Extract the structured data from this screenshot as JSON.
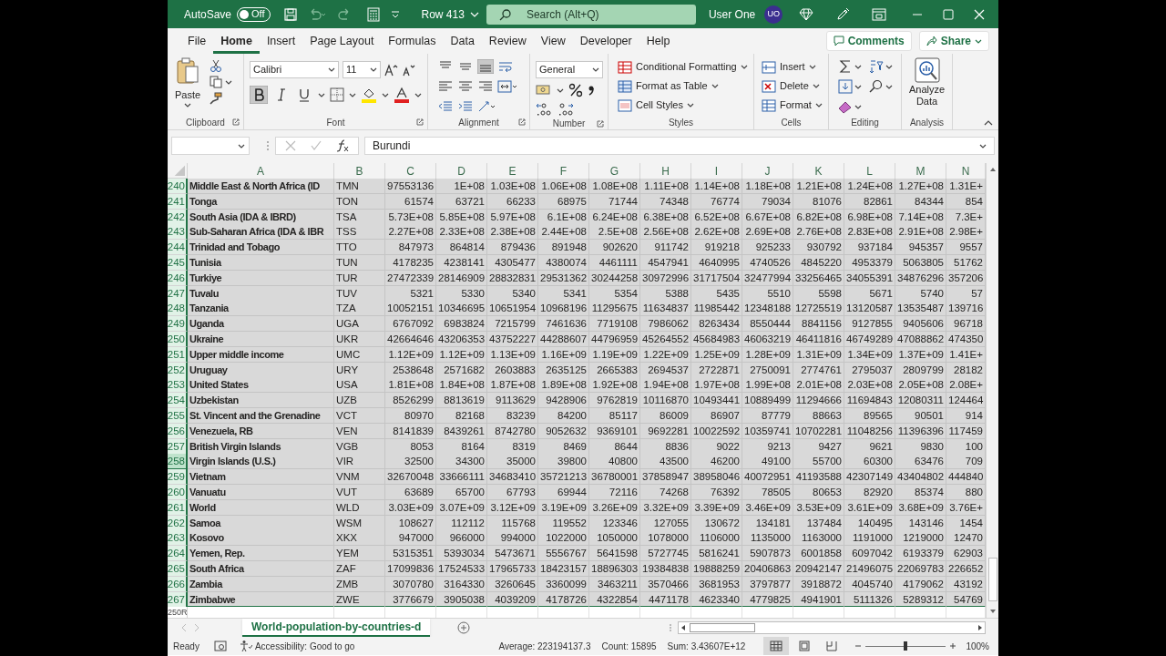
{
  "title_bar": {
    "autosave_label": "AutoSave",
    "autosave_toggle": {
      "label": "Off",
      "on": false
    },
    "file_name": "Row 413",
    "search": {
      "placeholder": "Search (Alt+Q)"
    },
    "user_name": "User One",
    "user_initials": "UO"
  },
  "ribbon_tabs": [
    {
      "label": "File",
      "selected": false
    },
    {
      "label": "Home",
      "selected": true
    },
    {
      "label": "Insert",
      "selected": false
    },
    {
      "label": "Page Layout",
      "selected": false
    },
    {
      "label": "Formulas",
      "selected": false
    },
    {
      "label": "Data",
      "selected": false
    },
    {
      "label": "Review",
      "selected": false
    },
    {
      "label": "View",
      "selected": false
    },
    {
      "label": "Developer",
      "selected": false
    },
    {
      "label": "Help",
      "selected": false
    }
  ],
  "comments_button": "Comments",
  "share_button": "Share",
  "clipboard": {
    "label": "Clipboard",
    "paste": "Paste"
  },
  "font": {
    "label": "Font",
    "font_name": "Calibri",
    "font_size": "11",
    "bold": true,
    "italic": false,
    "underline": false
  },
  "alignment": {
    "label": "Alignment"
  },
  "number": {
    "label": "Number",
    "format": "General"
  },
  "styles": {
    "label": "Styles",
    "items": [
      "Conditional Formatting",
      "Format as Table",
      "Cell Styles"
    ]
  },
  "cells": {
    "label": "Cells",
    "items": [
      "Insert",
      "Delete",
      "Format"
    ]
  },
  "editing": {
    "label": "Editing"
  },
  "analysis": {
    "label": "Analysis",
    "button": "Analyze Data"
  },
  "formula_bar": {
    "formula": "Burundi"
  },
  "sheet": {
    "columns": [
      "A",
      "B",
      "C",
      "D",
      "E",
      "F",
      "G",
      "H",
      "I",
      "J",
      "K",
      "L",
      "M",
      "N"
    ],
    "rows": [
      {
        "number": "240",
        "active": false,
        "selected": true,
        "cells": [
          "Middle East & North Africa (ID",
          "TMN",
          "97553136",
          "1E+08",
          "1.03E+08",
          "1.06E+08",
          "1.08E+08",
          "1.11E+08",
          "1.14E+08",
          "1.18E+08",
          "1.21E+08",
          "1.24E+08",
          "1.27E+08",
          "1.31E+"
        ]
      },
      {
        "number": "241",
        "active": false,
        "selected": true,
        "cells": [
          "Tonga",
          "TON",
          "61574",
          "63721",
          "66233",
          "68975",
          "71744",
          "74348",
          "76774",
          "79034",
          "81076",
          "82861",
          "84344",
          "854"
        ]
      },
      {
        "number": "242",
        "active": false,
        "selected": true,
        "cells": [
          "South Asia (IDA & IBRD)",
          "TSA",
          "5.73E+08",
          "5.85E+08",
          "5.97E+08",
          "6.1E+08",
          "6.24E+08",
          "6.38E+08",
          "6.52E+08",
          "6.67E+08",
          "6.82E+08",
          "6.98E+08",
          "7.14E+08",
          "7.3E+"
        ]
      },
      {
        "number": "243",
        "active": false,
        "selected": true,
        "cells": [
          "Sub-Saharan Africa (IDA & IBR",
          "TSS",
          "2.27E+08",
          "2.33E+08",
          "2.38E+08",
          "2.44E+08",
          "2.5E+08",
          "2.56E+08",
          "2.62E+08",
          "2.69E+08",
          "2.76E+08",
          "2.83E+08",
          "2.91E+08",
          "2.98E+"
        ]
      },
      {
        "number": "244",
        "active": false,
        "selected": true,
        "cells": [
          "Trinidad and Tobago",
          "TTO",
          "847973",
          "864814",
          "879436",
          "891948",
          "902620",
          "911742",
          "919218",
          "925233",
          "930792",
          "937184",
          "945357",
          "9557"
        ]
      },
      {
        "number": "245",
        "active": false,
        "selected": true,
        "cells": [
          "Tunisia",
          "TUN",
          "4178235",
          "4238141",
          "4305477",
          "4380074",
          "4461111",
          "4547941",
          "4640995",
          "4740526",
          "4845220",
          "4953379",
          "5063805",
          "51762"
        ]
      },
      {
        "number": "246",
        "active": false,
        "selected": true,
        "cells": [
          "Turkiye",
          "TUR",
          "27472339",
          "28146909",
          "28832831",
          "29531362",
          "30244258",
          "30972996",
          "31717504",
          "32477994",
          "33256465",
          "34055391",
          "34876296",
          "357206"
        ]
      },
      {
        "number": "247",
        "active": false,
        "selected": true,
        "cells": [
          "Tuvalu",
          "TUV",
          "5321",
          "5330",
          "5340",
          "5341",
          "5354",
          "5388",
          "5435",
          "5510",
          "5598",
          "5671",
          "5740",
          "57"
        ]
      },
      {
        "number": "248",
        "active": false,
        "selected": true,
        "cells": [
          "Tanzania",
          "TZA",
          "10052151",
          "10346695",
          "10651954",
          "10968196",
          "11295675",
          "11634837",
          "11985442",
          "12348188",
          "12725519",
          "13120587",
          "13535487",
          "139716"
        ]
      },
      {
        "number": "249",
        "active": false,
        "selected": true,
        "cells": [
          "Uganda",
          "UGA",
          "6767092",
          "6983824",
          "7215799",
          "7461636",
          "7719108",
          "7986062",
          "8263434",
          "8550444",
          "8841156",
          "9127855",
          "9405606",
          "96718"
        ]
      },
      {
        "number": "250",
        "active": false,
        "selected": true,
        "cells": [
          "Ukraine",
          "UKR",
          "42664646",
          "43206353",
          "43752227",
          "44288607",
          "44796959",
          "45264552",
          "45684983",
          "46063219",
          "46411816",
          "46749289",
          "47088862",
          "474350"
        ]
      },
      {
        "number": "251",
        "active": false,
        "selected": true,
        "cells": [
          "Upper middle income",
          "UMC",
          "1.12E+09",
          "1.12E+09",
          "1.13E+09",
          "1.16E+09",
          "1.19E+09",
          "1.22E+09",
          "1.25E+09",
          "1.28E+09",
          "1.31E+09",
          "1.34E+09",
          "1.37E+09",
          "1.41E+"
        ]
      },
      {
        "number": "252",
        "active": false,
        "selected": true,
        "cells": [
          "Uruguay",
          "URY",
          "2538648",
          "2571682",
          "2603883",
          "2635125",
          "2665383",
          "2694537",
          "2722871",
          "2750091",
          "2774761",
          "2795037",
          "2809799",
          "28182"
        ]
      },
      {
        "number": "253",
        "active": false,
        "selected": true,
        "cells": [
          "United States",
          "USA",
          "1.81E+08",
          "1.84E+08",
          "1.87E+08",
          "1.89E+08",
          "1.92E+08",
          "1.94E+08",
          "1.97E+08",
          "1.99E+08",
          "2.01E+08",
          "2.03E+08",
          "2.05E+08",
          "2.08E+"
        ]
      },
      {
        "number": "254",
        "active": false,
        "selected": true,
        "cells": [
          "Uzbekistan",
          "UZB",
          "8526299",
          "8813619",
          "9113629",
          "9428906",
          "9762819",
          "10116870",
          "10493441",
          "10889499",
          "11294666",
          "11694843",
          "12080311",
          "124464"
        ]
      },
      {
        "number": "255",
        "active": false,
        "selected": true,
        "cells": [
          "St. Vincent and the Grenadine",
          "VCT",
          "80970",
          "82168",
          "83239",
          "84200",
          "85117",
          "86009",
          "86907",
          "87779",
          "88663",
          "89565",
          "90501",
          "914"
        ]
      },
      {
        "number": "256",
        "active": false,
        "selected": true,
        "cells": [
          "Venezuela, RB",
          "VEN",
          "8141839",
          "8439261",
          "8742780",
          "9052632",
          "9369101",
          "9692281",
          "10022592",
          "10359741",
          "10702281",
          "11048256",
          "11396396",
          "117459"
        ]
      },
      {
        "number": "257",
        "active": false,
        "selected": true,
        "cells": [
          "British Virgin Islands",
          "VGB",
          "8053",
          "8164",
          "8319",
          "8469",
          "8644",
          "8836",
          "9022",
          "9213",
          "9427",
          "9621",
          "9830",
          "100"
        ]
      },
      {
        "number": "258",
        "active": true,
        "selected": true,
        "cells": [
          "Virgin Islands (U.S.)",
          "VIR",
          "32500",
          "34300",
          "35000",
          "39800",
          "40800",
          "43500",
          "46200",
          "49100",
          "55700",
          "60300",
          "63476",
          "709"
        ]
      },
      {
        "number": "259",
        "active": false,
        "selected": true,
        "cells": [
          "Vietnam",
          "VNM",
          "32670048",
          "33666111",
          "34683410",
          "35721213",
          "36780001",
          "37858947",
          "38958046",
          "40072951",
          "41193588",
          "42307149",
          "43404802",
          "444840"
        ]
      },
      {
        "number": "260",
        "active": false,
        "selected": true,
        "cells": [
          "Vanuatu",
          "VUT",
          "63689",
          "65700",
          "67793",
          "69944",
          "72116",
          "74268",
          "76392",
          "78505",
          "80653",
          "82920",
          "85374",
          "880"
        ]
      },
      {
        "number": "261",
        "active": false,
        "selected": true,
        "cells": [
          "World",
          "WLD",
          "3.03E+09",
          "3.07E+09",
          "3.12E+09",
          "3.19E+09",
          "3.26E+09",
          "3.32E+09",
          "3.39E+09",
          "3.46E+09",
          "3.53E+09",
          "3.61E+09",
          "3.68E+09",
          "3.76E+"
        ]
      },
      {
        "number": "262",
        "active": false,
        "selected": true,
        "cells": [
          "Samoa",
          "WSM",
          "108627",
          "112112",
          "115768",
          "119552",
          "123346",
          "127055",
          "130672",
          "134181",
          "137484",
          "140495",
          "143146",
          "1454"
        ]
      },
      {
        "number": "263",
        "active": false,
        "selected": true,
        "cells": [
          "Kosovo",
          "XKX",
          "947000",
          "966000",
          "994000",
          "1022000",
          "1050000",
          "1078000",
          "1106000",
          "1135000",
          "1163000",
          "1191000",
          "1219000",
          "12470"
        ]
      },
      {
        "number": "264",
        "active": false,
        "selected": true,
        "cells": [
          "Yemen, Rep.",
          "YEM",
          "5315351",
          "5393034",
          "5473671",
          "5556767",
          "5641598",
          "5727745",
          "5816241",
          "5907873",
          "6001858",
          "6097042",
          "6193379",
          "62903"
        ]
      },
      {
        "number": "265",
        "active": false,
        "selected": true,
        "cells": [
          "South Africa",
          "ZAF",
          "17099836",
          "17524533",
          "17965733",
          "18423157",
          "18896303",
          "19384838",
          "19888259",
          "20406863",
          "20942147",
          "21496075",
          "22069783",
          "226652"
        ]
      },
      {
        "number": "266",
        "active": false,
        "selected": true,
        "cells": [
          "Zambia",
          "ZMB",
          "3070780",
          "3164330",
          "3260645",
          "3360099",
          "3463211",
          "3570466",
          "3681953",
          "3797877",
          "3918872",
          "4045740",
          "4179062",
          "43192"
        ]
      },
      {
        "number": "267",
        "active": false,
        "selected": true,
        "cells": [
          "Zimbabwe",
          "ZWE",
          "3776679",
          "3905038",
          "4039209",
          "4178726",
          "4322854",
          "4471178",
          "4623340",
          "4779825",
          "4941901",
          "5111326",
          "5289312",
          "54769"
        ]
      }
    ],
    "selection_size": "250R"
  },
  "sheet_tabs": [
    {
      "label": "World-population-by-countries-d",
      "selected": true
    }
  ],
  "status_bar": {
    "mode": "Ready",
    "accessibility": "Accessibility: Good to go",
    "average": "Average: 223194137.3",
    "count": "Count: 15895",
    "sum": "Sum: 3.43607E+12",
    "zoom": {
      "level": 0.5
    },
    "zoom_label": "100%"
  }
}
